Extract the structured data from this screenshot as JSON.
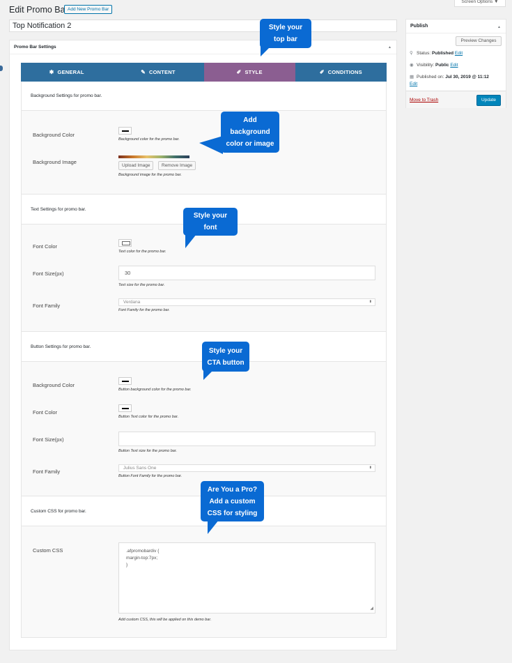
{
  "page": {
    "title": "Edit Promo Bar",
    "add_new_label": "Add New Promo Bar",
    "screen_options_label": "Screen Options ▼",
    "post_title": "Top Notification 2"
  },
  "settings_box": {
    "title": "Promo Bar Settings",
    "tabs": [
      {
        "label": "GENERAL",
        "icon": "gear-icon",
        "glyph": "✱"
      },
      {
        "label": "CONTENT",
        "icon": "pencil-icon",
        "glyph": "✎"
      },
      {
        "label": "STYLE",
        "icon": "brush-icon",
        "glyph": "✐",
        "active": true
      },
      {
        "label": "CONDITIONS",
        "icon": "wrench-icon",
        "glyph": "✐"
      }
    ]
  },
  "background": {
    "section_title": "Background Settings for promo bar.",
    "color_label": "Background Color",
    "color_desc": "Background color for the promo bar.",
    "image_label": "Background Image",
    "upload_label": "Upload Image",
    "remove_label": "Remove Image",
    "image_desc": "Background image for the promo bar."
  },
  "text": {
    "section_title": "Text Settings for promo bar.",
    "font_color_label": "Font Color",
    "font_color_desc": "Text color for the promo bar.",
    "font_size_label": "Font Size(px)",
    "font_size_value": "30",
    "font_size_desc": "Text size for the promo bar.",
    "font_family_label": "Font Family",
    "font_family_value": "Verdana",
    "font_family_desc": "Font Family for the promo bar."
  },
  "button": {
    "section_title": "Button Settings for promo bar.",
    "bg_label": "Background Color",
    "bg_desc": "Button background color for the promo bar.",
    "font_color_label": "Font Color",
    "font_color_desc": "Button Text color for the promo bar.",
    "font_size_label": "Font Size(px)",
    "font_size_value": "",
    "font_size_desc": "Button Text size for the promo bar.",
    "font_family_label": "Font Family",
    "font_family_value": "Julius Sans One",
    "font_family_desc": "Button Font Family for the promo bar."
  },
  "css": {
    "section_title": "Custom CSS for promo bar.",
    "label": "Custom CSS",
    "lines": [
      ".afpromobardiv {",
      "margin-top:7px;",
      "}"
    ],
    "desc": "Add custom CSS, this will be applied on this demo bar."
  },
  "publish": {
    "title": "Publish",
    "preview_label": "Preview Changes",
    "status_label": "Status:",
    "status_value": "Published",
    "visibility_label": "Visibility:",
    "visibility_value": "Public",
    "published_label": "Published on:",
    "published_value": "Jul 30, 2019 @ 11:12",
    "edit_label": "Edit",
    "trash_label": "Move to Trash",
    "update_label": "Update"
  },
  "callouts": {
    "style_top_bar": "Style your\ntop bar",
    "add_background": "Add\nbackground\ncolor or image",
    "style_font": "Style your\nfont",
    "style_cta": "Style your\nCTA button",
    "custom_css": "Are You a Pro?\nAdd a custom\nCSS for styling"
  },
  "colors": {
    "tab_bar": "#2e6e9e",
    "tab_active": "#8b5e91",
    "callout": "#0a6ad3",
    "update_button": "#0085ba"
  }
}
